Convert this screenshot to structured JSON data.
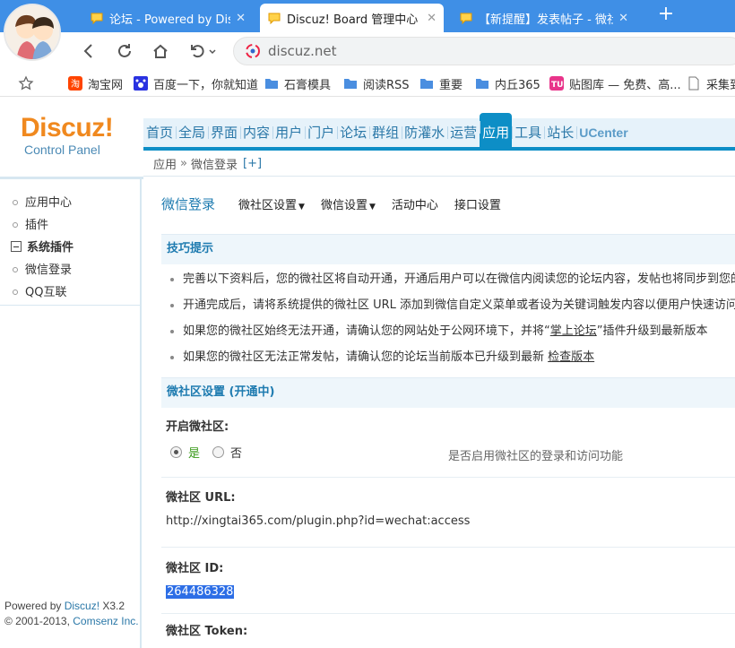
{
  "browser": {
    "tabs": [
      {
        "title": "论坛 - Powered by Discu",
        "active": false
      },
      {
        "title": "Discuz! Board 管理中心 -",
        "active": true
      },
      {
        "title": "【新提醒】发表帖子 - 微社",
        "active": false
      }
    ],
    "new_tab_label": "+",
    "url": "discuz.net",
    "bookmarks": [
      {
        "label": "淘宝网",
        "icon": "taobao-icon"
      },
      {
        "label": "百度一下，你就知道",
        "icon": "baidu-icon"
      },
      {
        "label": "石膏模具",
        "icon": "folder-icon"
      },
      {
        "label": "阅读RSS",
        "icon": "folder-icon"
      },
      {
        "label": "重要",
        "icon": "folder-icon"
      },
      {
        "label": "内丘365",
        "icon": "folder-icon"
      },
      {
        "label": "贴图库 — 免费、高...",
        "icon": "tietuku-icon"
      },
      {
        "label": "采集到",
        "icon": "page-icon"
      }
    ]
  },
  "logo": {
    "line1": "Discuz!",
    "line2": "Control Panel"
  },
  "topnav": [
    "首页",
    "全局",
    "界面",
    "内容",
    "用户",
    "门户",
    "论坛",
    "群组",
    "防灌水",
    "运营",
    "应用",
    "工具",
    "站长",
    "UCenter"
  ],
  "topnav_active": "应用",
  "breadcrumb": {
    "root": "应用",
    "sep": "»",
    "current": "微信登录",
    "add": "[+]"
  },
  "sidebar": {
    "items": [
      {
        "label": "应用中心",
        "type": "item"
      },
      {
        "label": "插件",
        "type": "item"
      },
      {
        "label": "系统插件",
        "type": "group"
      },
      {
        "label": "微信登录",
        "type": "item"
      },
      {
        "label": "QQ互联",
        "type": "item"
      }
    ],
    "footer": {
      "powered_prefix": "Powered by ",
      "powered_link": "Discuz!",
      "powered_version": " X3.2",
      "copy_prefix": "© 2001-2013, ",
      "copy_link": "Comsenz Inc."
    }
  },
  "subnav": {
    "title": "微信登录",
    "links": [
      {
        "label": "微社区设置",
        "dropdown": true
      },
      {
        "label": "微信设置",
        "dropdown": true
      },
      {
        "label": "活动中心",
        "dropdown": false
      },
      {
        "label": "接口设置",
        "dropdown": false
      }
    ],
    "caret": "▼"
  },
  "tips": {
    "title": "技巧提示",
    "items": [
      {
        "text": "完善以下资料后，您的微社区将自动开通，开通后用户可以在微信内阅读您的论坛内容，发帖也将同步到您的论坛"
      },
      {
        "text": "开通完成后，请将系统提供的微社区 URL 添加到微信自定义菜单或者设为关键词触发内容以便用户快速访问"
      },
      {
        "text": "如果您的微社区始终无法开通，请确认您的网站处于公网环境下，并将“",
        "link": "掌上论坛",
        "after": "”插件升级到最新版本"
      },
      {
        "text": "如果您的微社区无法正常发帖，请确认您的论坛当前版本已升级到最新 ",
        "link": "检查版本"
      }
    ]
  },
  "settings": {
    "title": "微社区设置 (开通中)",
    "enable_label": "开启微社区:",
    "yes": "是",
    "no": "否",
    "selected": "yes",
    "enable_hint": "是否启用微社区的登录和访问功能",
    "url_label": "微社区 URL:",
    "url_value": "http://xingtai365.com/plugin.php?id=wechat:access",
    "id_label": "微社区 ID:",
    "id_value": "264486328",
    "token_label": "微社区 Token:"
  },
  "colors": {
    "accent": "#0d8ec6",
    "link": "#1e7bb0",
    "logo": "#f0891f",
    "selection": "#2d6ee6"
  }
}
